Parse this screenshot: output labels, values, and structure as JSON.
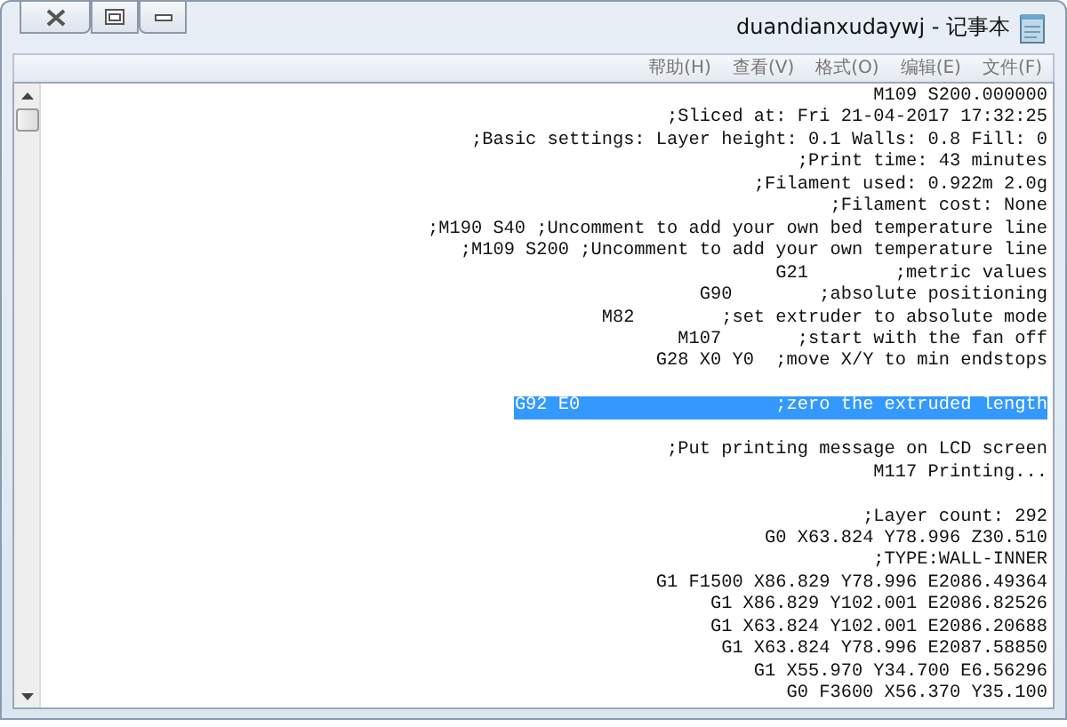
{
  "window": {
    "title": "duandianxudaywj - 记事本",
    "mirrored": true
  },
  "menu": [
    {
      "label": "帮助(H)"
    },
    {
      "label": "查看(V)"
    },
    {
      "label": "格式(O)"
    },
    {
      "label": "编辑(E)"
    },
    {
      "label": "文件(F)"
    }
  ],
  "lines": [
    {
      "kind": "text",
      "text": "M109 S200.000000",
      "selected": false
    },
    {
      "kind": "text",
      "text": ";Sliced at: Fri 21-04-2017 17:32:25",
      "selected": false
    },
    {
      "kind": "text",
      "text": ";Basic settings: Layer height: 0.1 Walls: 0.8 Fill: 0",
      "selected": false
    },
    {
      "kind": "text",
      "text": ";Print time: 43 minutes",
      "selected": false
    },
    {
      "kind": "text",
      "text": ";Filament used: 0.922m 2.0g",
      "selected": false
    },
    {
      "kind": "text",
      "text": ";Filament cost: None",
      "selected": false
    },
    {
      "kind": "text",
      "text": ";M190 S40 ;Uncomment to add your own bed temperature line",
      "selected": false
    },
    {
      "kind": "text",
      "text": ";M109 S200 ;Uncomment to add your own temperature line",
      "selected": false
    },
    {
      "kind": "text",
      "text": "G21        ;metric values",
      "selected": false
    },
    {
      "kind": "text",
      "text": "G90        ;absolute positioning",
      "selected": false
    },
    {
      "kind": "text",
      "text": "M82        ;set extruder to absolute mode",
      "selected": false
    },
    {
      "kind": "text",
      "text": "M107       ;start with the fan off",
      "selected": false
    },
    {
      "kind": "text",
      "text": "G28 X0 Y0  ;move X/Y to min endstops",
      "selected": false
    },
    {
      "kind": "blank"
    },
    {
      "kind": "text",
      "text": "G92 E0                  ;zero the extruded length",
      "selected": true
    },
    {
      "kind": "blank"
    },
    {
      "kind": "text",
      "text": ";Put printing message on LCD screen",
      "selected": false
    },
    {
      "kind": "text",
      "text": "M117 Printing...",
      "selected": false
    },
    {
      "kind": "blank"
    },
    {
      "kind": "text",
      "text": ";Layer count: 292",
      "selected": false
    },
    {
      "kind": "text",
      "text": "G0 X63.824 Y78.996 Z30.510",
      "selected": false
    },
    {
      "kind": "text",
      "text": ";TYPE:WALL-INNER",
      "selected": false
    },
    {
      "kind": "text",
      "text": "G1 F1500 X86.829 Y78.996 E2086.49364",
      "selected": false
    },
    {
      "kind": "text",
      "text": "G1 X86.829 Y102.001 E2086.82526",
      "selected": false
    },
    {
      "kind": "text",
      "text": "G1 X63.824 Y102.001 E2086.20688",
      "selected": false
    },
    {
      "kind": "text",
      "text": "G1 X63.824 Y78.996 E2087.58850",
      "selected": false
    },
    {
      "kind": "text",
      "text": "G1 X55.970 Y34.700 E6.56296",
      "selected": false
    },
    {
      "kind": "text",
      "text": "G0 F3600 X56.370 Y35.100",
      "selected": false
    }
  ]
}
